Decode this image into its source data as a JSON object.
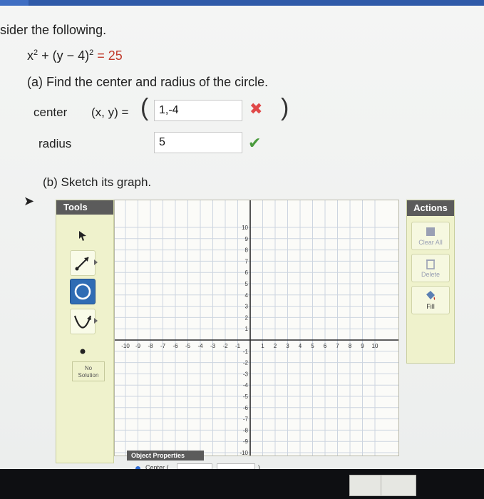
{
  "question": {
    "instruction": "sider the following.",
    "equation": {
      "lhs_a": "x",
      "exp1": "2",
      "mid": " + (y − 4)",
      "exp2": "2",
      "rhs": " = 25"
    },
    "part_a": "(a) Find the center and radius of the circle.",
    "center": {
      "label": "center",
      "xy_label": "(x, y) =",
      "open_paren": "(",
      "close_paren": ")",
      "value": "1,-4",
      "status": "incorrect"
    },
    "radius": {
      "label": "radius",
      "value": "5",
      "status": "correct"
    },
    "part_b": "(b) Sketch its graph."
  },
  "tools": {
    "header": "Tools",
    "items": [
      {
        "name": "pointer-icon",
        "selected": false
      },
      {
        "name": "line-icon",
        "selected": false
      },
      {
        "name": "circle-icon",
        "selected": true
      },
      {
        "name": "parabola-icon",
        "selected": false
      },
      {
        "name": "point-icon",
        "selected": false
      }
    ],
    "no_solution": {
      "line1": "No",
      "line2": "Solution"
    }
  },
  "graph": {
    "x_range": [
      -10,
      10
    ],
    "y_range": [
      -10,
      10
    ],
    "x_ticks": [
      "-10",
      "-9",
      "-8",
      "-7",
      "-6",
      "-5",
      "-4",
      "-3",
      "-2",
      "-1",
      "1",
      "2",
      "3",
      "4",
      "5",
      "6",
      "7",
      "8",
      "9",
      "10"
    ],
    "y_ticks": [
      "10",
      "9",
      "8",
      "7",
      "6",
      "5",
      "4",
      "3",
      "2",
      "1",
      "-1",
      "-2",
      "-3",
      "-4",
      "-5",
      "-6",
      "-7",
      "-8",
      "-9",
      "-10"
    ],
    "grid_color": "#cdd5e0",
    "axis_color": "#2b2b2b"
  },
  "actions": {
    "header": "Actions",
    "clear_all": "Clear All",
    "delete": "Delete",
    "fill": "Fill"
  },
  "object_properties": {
    "header": "Object Properties",
    "center_label": "Center (",
    "close_paren": ")"
  },
  "colors": {
    "incorrect": "#e04848",
    "correct": "#4b9b3e",
    "selected_tool": "#2f6cb4"
  }
}
